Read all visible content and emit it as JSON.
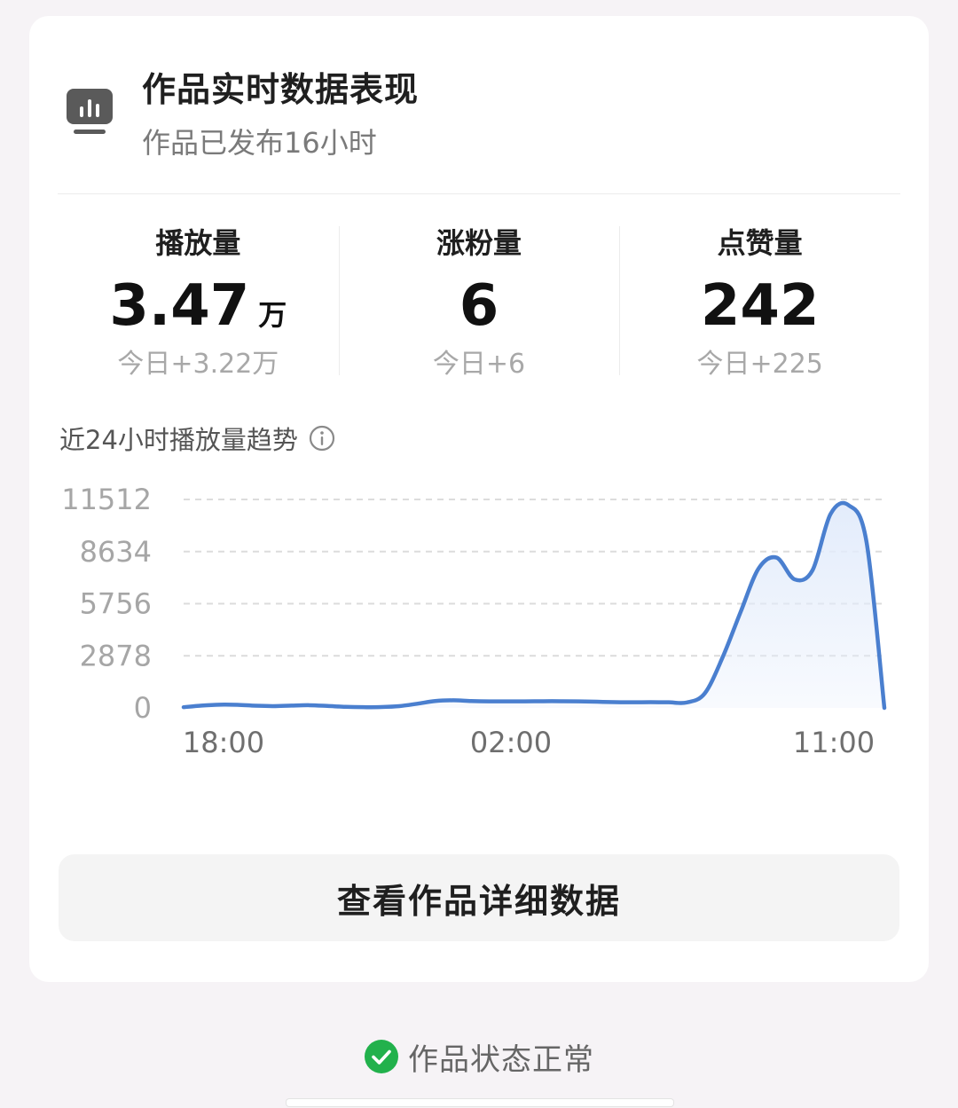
{
  "header": {
    "icon": "bar-chart-icon",
    "title": "作品实时数据表现",
    "subtitle": "作品已发布16小时"
  },
  "stats": [
    {
      "label": "播放量",
      "value": "3.47",
      "unit": "万",
      "today": "今日+3.22万"
    },
    {
      "label": "涨粉量",
      "value": "6",
      "unit": "",
      "today": "今日+6"
    },
    {
      "label": "点赞量",
      "value": "242",
      "unit": "",
      "today": "今日+225"
    }
  ],
  "trend": {
    "title": "近24小时播放量趋势",
    "info_icon": "info-icon"
  },
  "chart_data": {
    "type": "area",
    "title": "",
    "xlabel": "",
    "ylabel": "",
    "x_ticks": [
      "18:00",
      "02:00",
      "11:00"
    ],
    "y_ticks": [
      0,
      2878,
      5756,
      8634,
      11512
    ],
    "ylim": [
      0,
      11512
    ],
    "grid": true,
    "line_color": "#4a7fcf",
    "fill_color": "#e3ecfb",
    "series": [
      {
        "values": [
          40,
          130,
          180,
          170,
          120,
          100,
          130,
          150,
          110,
          60,
          40,
          50,
          100,
          230,
          380,
          420,
          380,
          360,
          360,
          360,
          370,
          370,
          360,
          340,
          320,
          310,
          320,
          310,
          300,
          800,
          2800,
          5300,
          7700,
          8300,
          7100,
          7600,
          10700,
          11200,
          9200,
          0
        ]
      }
    ]
  },
  "actions": {
    "detail_button": "查看作品详细数据"
  },
  "status": {
    "icon": "check-circle-icon",
    "text": "作品状态正常",
    "color": "#22b14c"
  }
}
